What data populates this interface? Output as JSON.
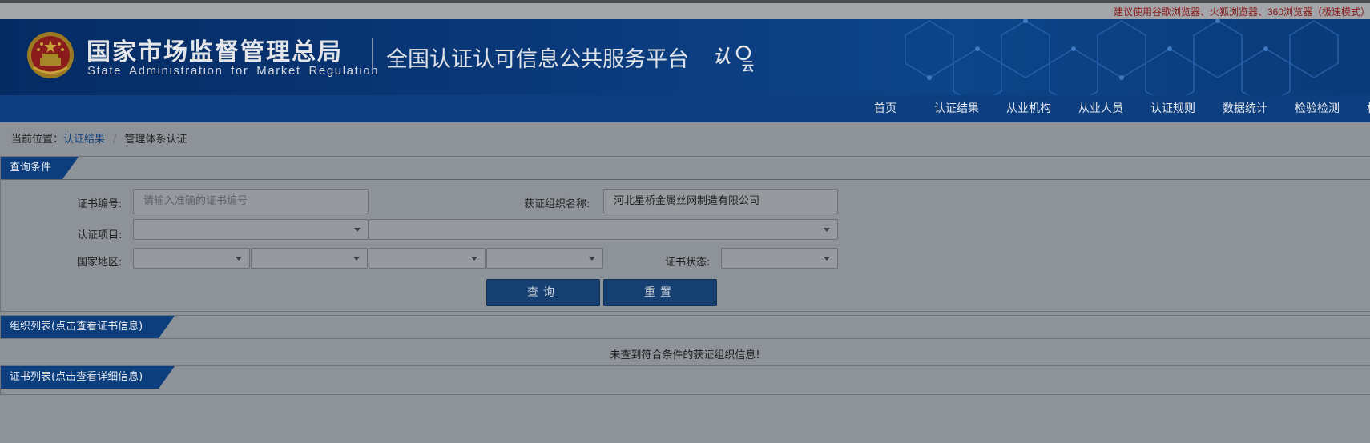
{
  "browser_notice": "建议使用谷歌浏览器、火狐浏览器、360浏览器（极速模式）",
  "header": {
    "agency_name_cn": "国家市场监督管理总局",
    "agency_name_en": "State Administration for Market Regulation",
    "platform_title": "全国认证认可信息公共服务平台",
    "cloud_logo_text": "认云"
  },
  "nav": {
    "items": [
      "首页",
      "认证结果",
      "从业机构",
      "从业人员",
      "认证规则",
      "数据统计",
      "检验检测",
      "标"
    ]
  },
  "breadcrumb": {
    "prefix": "当前位置：",
    "parent": "认证结果",
    "separator": "/",
    "current": "管理体系认证"
  },
  "query_panel": {
    "title": "查询条件",
    "cert_number_label": "证书编号:",
    "cert_number_placeholder": "请输入准确的证书编号",
    "cert_number_value": "",
    "org_name_label": "获证组织名称:",
    "org_name_value": "河北星桥金属丝网制造有限公司",
    "cert_project_label": "认证项目:",
    "region_label": "国家地区:",
    "cert_status_label": "证书状态:",
    "search_button": "查询",
    "reset_button": "重置"
  },
  "org_list_panel": {
    "title": "组织列表(点击查看证书信息)",
    "empty_message": "未查到符合条件的获证组织信息!"
  },
  "cert_list_panel": {
    "title": "证书列表(点击查看详细信息)"
  },
  "colors": {
    "banner": "#0b3b7d",
    "nav": "#0d3f80",
    "button": "#163f72",
    "notice": "#8c1818"
  }
}
